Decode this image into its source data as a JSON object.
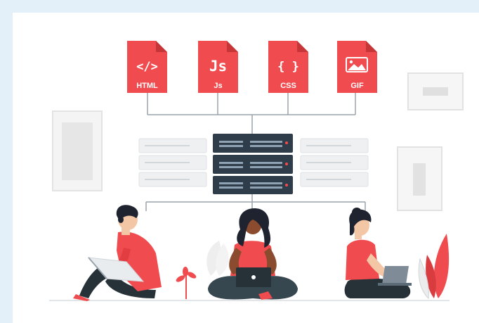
{
  "files": [
    {
      "label": "HTML",
      "glyph": "</>",
      "icon": "code-tag-icon"
    },
    {
      "label": "Js",
      "glyph": "Js",
      "icon": "javascript-icon"
    },
    {
      "label": "CSS",
      "glyph": "{ }",
      "icon": "curly-braces-icon"
    },
    {
      "label": "GIF",
      "glyph": "",
      "icon": "image-icon"
    }
  ],
  "colors": {
    "background": "#e3eff9",
    "accent": "#f04b4e",
    "server": "#2f3d4a",
    "server_light": "#eef0f2",
    "skin": "#f3c6a6",
    "skin_dark": "#8a4b2e",
    "hair": "#1f2330",
    "pants": "#263238"
  }
}
